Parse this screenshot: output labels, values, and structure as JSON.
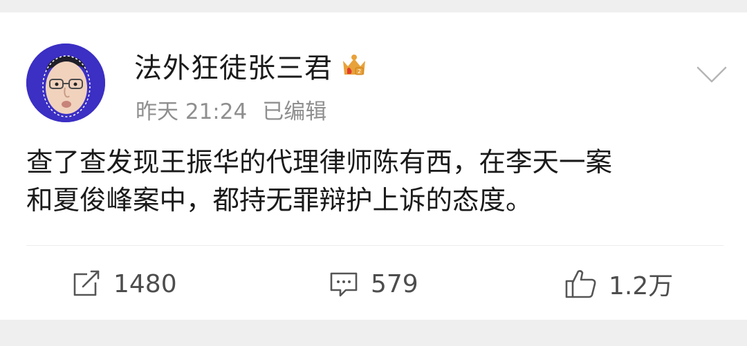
{
  "post": {
    "author": "法外狂徒张三君",
    "time": "昨天 21:24",
    "edited": "已编辑",
    "text": "查了查发现王振华的代理律师陈有西，在李天一案\n和夏俊峰案中，都持无罪辩护上诉的态度。"
  },
  "actions": {
    "repost_count": "1480",
    "comment_count": "579",
    "like_count": "1.2万"
  },
  "icons": {
    "vip": "crown-badge-icon",
    "menu": "chevron-down-icon",
    "repost": "repost-icon",
    "comment": "comment-icon",
    "like": "thumbs-up-icon"
  },
  "colors": {
    "avatar_bg": "#3b2fc4",
    "vip_gold": "#e8a23a",
    "vip_red": "#e23b2b",
    "meta_text": "#8f8f8f",
    "background": "#efefef"
  }
}
